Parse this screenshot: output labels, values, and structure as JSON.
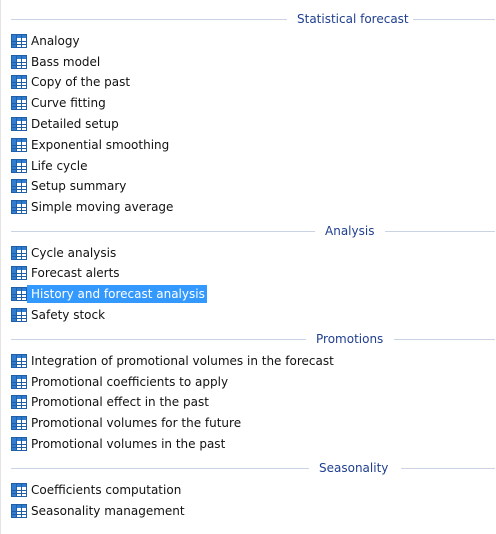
{
  "sections": [
    {
      "title": "Statistical forecast",
      "items": [
        {
          "label": "Analogy",
          "icon": "table-icon"
        },
        {
          "label": "Bass model",
          "icon": "table-icon"
        },
        {
          "label": "Copy of the past",
          "icon": "table-icon"
        },
        {
          "label": "Curve fitting",
          "icon": "table-icon"
        },
        {
          "label": "Detailed setup",
          "icon": "table-icon"
        },
        {
          "label": "Exponential smoothing",
          "icon": "table-icon"
        },
        {
          "label": "Life cycle",
          "icon": "table-icon"
        },
        {
          "label": "Setup summary",
          "icon": "table-icon"
        },
        {
          "label": "Simple moving average",
          "icon": "table-icon"
        }
      ]
    },
    {
      "title": "Analysis",
      "items": [
        {
          "label": "Cycle analysis",
          "icon": "table-icon"
        },
        {
          "label": "Forecast alerts",
          "icon": "table-icon"
        },
        {
          "label": "History and forecast analysis",
          "icon": "table-icon",
          "selected": true
        },
        {
          "label": "Safety stock",
          "icon": "table-icon"
        }
      ]
    },
    {
      "title": "Promotions",
      "items": [
        {
          "label": "Integration of promotional volumes in the forecast",
          "icon": "table-icon"
        },
        {
          "label": "Promotional coefficients to apply",
          "icon": "table-icon"
        },
        {
          "label": "Promotional effect in the past",
          "icon": "table-icon"
        },
        {
          "label": "Promotional volumes for the future",
          "icon": "table-icon"
        },
        {
          "label": "Promotional volumes in the past",
          "icon": "table-icon"
        }
      ]
    },
    {
      "title": "Seasonality",
      "items": [
        {
          "label": "Coefficients computation",
          "icon": "table-icon"
        },
        {
          "label": "Seasonality management",
          "icon": "table-icon"
        }
      ]
    }
  ],
  "colors": {
    "header_text": "#1f3f8f",
    "header_line": "#c9d3e3",
    "selection_bg": "#3399ff",
    "selection_text": "#ffffff",
    "icon_border": "#1e5fa8",
    "icon_header": "#2f7cd0",
    "icon_cell": "#ffffff"
  }
}
